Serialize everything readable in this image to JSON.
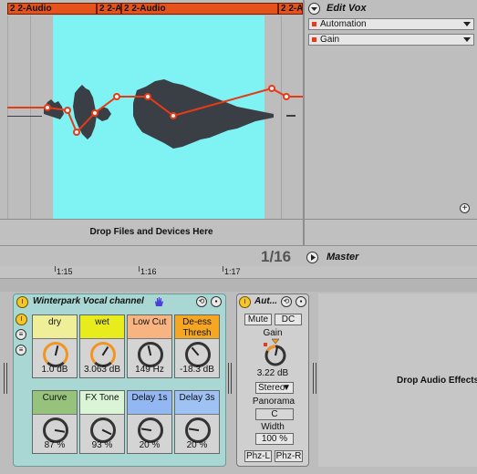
{
  "arrangement": {
    "clips": [
      {
        "label": "2 2-Audio"
      },
      {
        "label": "2 2-A"
      },
      {
        "label": "2 2-Audio"
      },
      {
        "label": "2 2-A"
      }
    ]
  },
  "side_panel": {
    "track_title": "Edit Vox",
    "device_chooser": "Automation",
    "parameter_chooser": "Gain"
  },
  "drop_zone": {
    "label": "Drop Files and Devices Here"
  },
  "master": {
    "quantization": "1/16",
    "label": "Master"
  },
  "timeline": {
    "labels": [
      "1:15",
      "1:16",
      "1:17"
    ]
  },
  "rack": {
    "title": "Winterpark Vocal channel",
    "macros": [
      {
        "label": "dry",
        "value": "1.0 dB",
        "level": 0.55,
        "color": "#efef9a"
      },
      {
        "label": "wet",
        "value": "3.063 dB",
        "level": 0.62,
        "color": "#e9ec1c"
      },
      {
        "label": "Low  Cut",
        "value": "149 Hz",
        "level": 0.45,
        "color": "#f7b481"
      },
      {
        "label": "De-ess Thresh",
        "value": "-18.3 dB",
        "level": 0.35,
        "color": "#f5a623"
      },
      {
        "label": "Curve",
        "value": "87 %",
        "level": 0.87,
        "color": "#96c27c"
      },
      {
        "label": "FX  Tone",
        "value": "93 %",
        "level": 0.93,
        "color": "#d9f5d6"
      },
      {
        "label": "Delay  1s",
        "value": "20 %",
        "level": 0.2,
        "color": "#93b7f2"
      },
      {
        "label": "Delay  3s",
        "value": "20 %",
        "level": 0.2,
        "color": "#9ec2f4"
      }
    ]
  },
  "utility": {
    "title": "Aut...",
    "mute": "Mute",
    "dc": "DC",
    "gain_label": "Gain",
    "gain_value": "3.22 dB",
    "channel_mode": "Stereo",
    "panorama_label": "Panorama",
    "panorama_value": "C",
    "width_label": "Width",
    "width_value": "100 %",
    "phz_l": "Phz-L",
    "phz_r": "Phz-R"
  },
  "drop_effects": {
    "label": "Drop Audio Effects"
  },
  "colors": {
    "clip": "#e5521c",
    "selection": "#7ff3f3",
    "automation": "#e63b17",
    "rack": "#a9d7d4"
  }
}
